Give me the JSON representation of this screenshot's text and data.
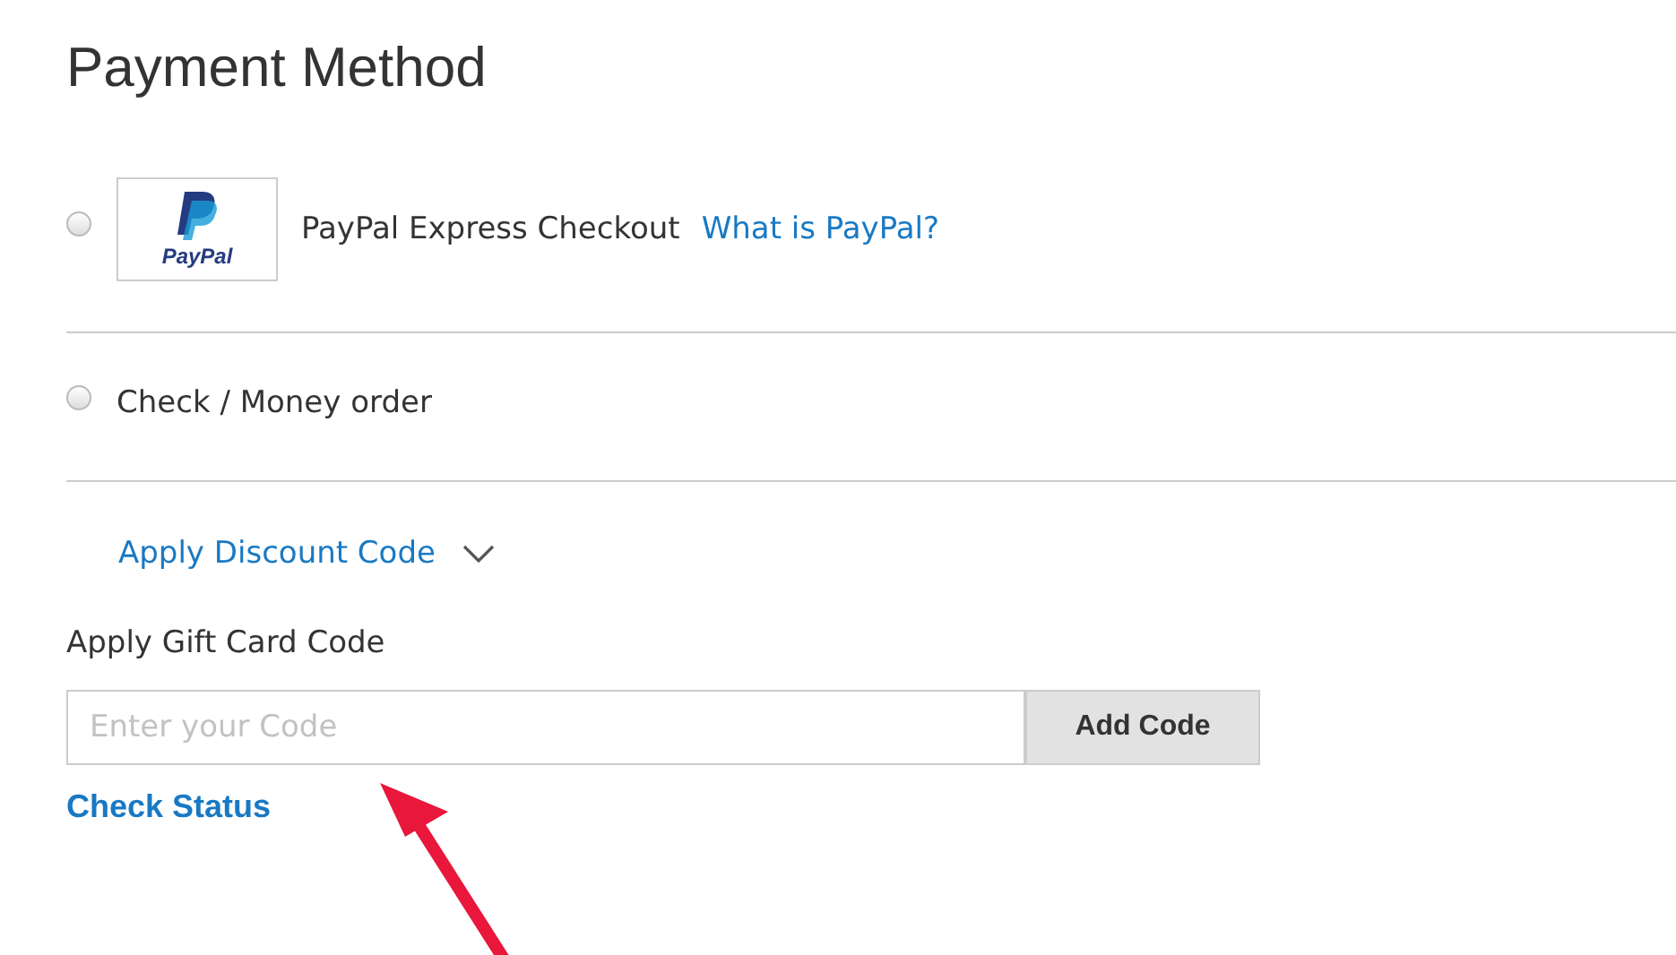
{
  "title": "Payment Method",
  "methods": [
    {
      "kind": "paypal",
      "logo_text": "PayPal",
      "label": "PayPal Express Checkout",
      "link": "What is PayPal?",
      "selected": false
    },
    {
      "kind": "plain",
      "label": "Check / Money order",
      "selected": false
    }
  ],
  "discount": {
    "label": "Apply Discount Code",
    "expanded": false
  },
  "gift_card": {
    "label": "Apply Gift Card Code",
    "placeholder": "Enter your Code",
    "button": "Add Code",
    "status_link": "Check Status"
  }
}
